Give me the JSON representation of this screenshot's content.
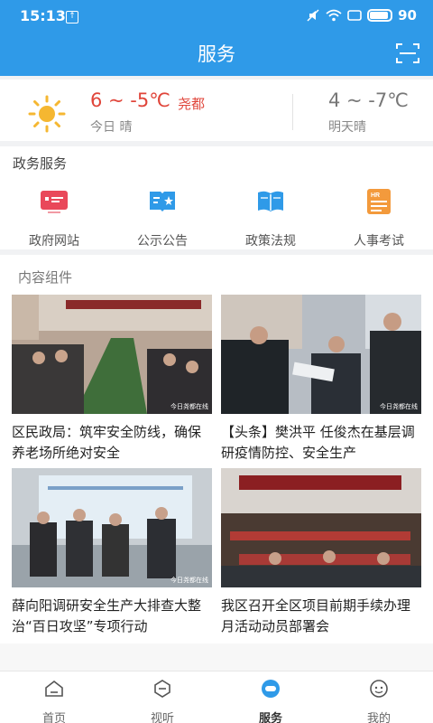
{
  "status_bar": {
    "time": "15:13",
    "battery": "90"
  },
  "header": {
    "title": "服务",
    "scan_icon": "scan-icon"
  },
  "weather": {
    "today_temp": "6 ~ -5℃",
    "city": "尧都",
    "today_desc": "今日 晴",
    "tomorrow_temp": "4 ~ -7℃",
    "tomorrow_desc": "明天晴",
    "sun_color": "#f5b731"
  },
  "gov_services": {
    "title": "政务服务",
    "items": [
      {
        "label": "政府网站",
        "icon": "government-site-icon",
        "color": "#e9485a"
      },
      {
        "label": "公示公告",
        "icon": "announcement-icon",
        "color": "#2f9ae8"
      },
      {
        "label": "政策法规",
        "icon": "policy-book-icon",
        "color": "#2f9ae8"
      },
      {
        "label": "人事考试",
        "icon": "hr-exam-icon",
        "color": "#f39a3c"
      }
    ]
  },
  "content": {
    "title": "内容组件",
    "cards": [
      {
        "caption": "区民政局：筑牢安全防线，确保养老场所绝对安全",
        "watermark": "今日尧都在线"
      },
      {
        "caption": "【头条】樊洪平 任俊杰在基层调研疫情防控、安全生产",
        "watermark": "今日尧都在线"
      },
      {
        "caption": "薛向阳调研安全生产大排查大整治“百日攻坚”专项行动",
        "watermark": "今日尧都在线"
      },
      {
        "caption": "我区召开全区项目前期手续办理月活动动员部署会",
        "watermark": ""
      }
    ]
  },
  "bottom_nav": {
    "items": [
      {
        "label": "首页",
        "icon": "home-icon",
        "active": false
      },
      {
        "label": "视听",
        "icon": "video-icon",
        "active": false
      },
      {
        "label": "服务",
        "icon": "service-icon",
        "active": true
      },
      {
        "label": "我的",
        "icon": "profile-icon",
        "active": false
      }
    ],
    "active_color": "#2f9ae8"
  }
}
